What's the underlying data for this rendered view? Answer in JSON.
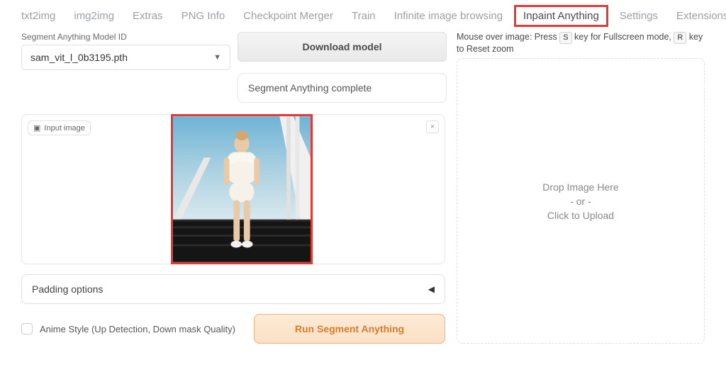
{
  "tabs": [
    {
      "label": "txt2img",
      "active": false
    },
    {
      "label": "img2img",
      "active": false
    },
    {
      "label": "Extras",
      "active": false
    },
    {
      "label": "PNG Info",
      "active": false
    },
    {
      "label": "Checkpoint Merger",
      "active": false
    },
    {
      "label": "Train",
      "active": false
    },
    {
      "label": "Infinite image browsing",
      "active": false
    },
    {
      "label": "Inpaint Anything",
      "active": true
    },
    {
      "label": "Settings",
      "active": false
    },
    {
      "label": "Extensions",
      "active": false
    }
  ],
  "left": {
    "model_label": "Segment Anything Model ID",
    "model_value": "sam_vit_l_0b3195.pth"
  },
  "mid": {
    "download_btn": "Download model",
    "status_text": "Segment Anything complete"
  },
  "image_card": {
    "badge": "Input image",
    "close": "×"
  },
  "accordion": {
    "label": "Padding options",
    "arrow": "◀"
  },
  "checkbox": {
    "label": "Anime Style (Up Detection, Down mask Quality)"
  },
  "run_btn": "Run Segment Anything",
  "right": {
    "hint_pre": "Mouse over image: Press",
    "key1": "S",
    "hint_mid": "key for Fullscreen mode,",
    "key2": "R",
    "hint_post": "key to Reset zoom",
    "drop1": "Drop Image Here",
    "drop2": "- or -",
    "drop3": "Click to Upload"
  }
}
